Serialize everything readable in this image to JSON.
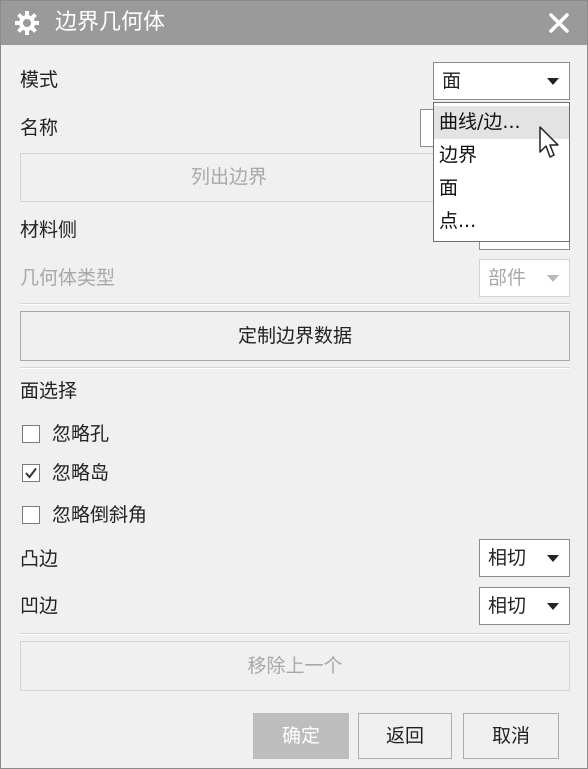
{
  "dialog": {
    "title": "边界几何体",
    "icons": {
      "settings": "gear-icon",
      "close": "close-icon"
    }
  },
  "mode": {
    "label": "模式",
    "value": "面"
  },
  "name": {
    "label": "名称"
  },
  "list_boundary_button": "列出边界",
  "material_side": {
    "label": "材料侧"
  },
  "geometry_type": {
    "label": "几何体类型",
    "value": "部件"
  },
  "custom_boundary_button": "定制边界数据",
  "face_selection": {
    "label": "面选择",
    "checkboxes": [
      {
        "label": "忽略孔",
        "checked": false
      },
      {
        "label": "忽略岛",
        "checked": true
      },
      {
        "label": "忽略倒斜角",
        "checked": false
      }
    ]
  },
  "convex_edge": {
    "label": "凸边",
    "value": "相切"
  },
  "concave_edge": {
    "label": "凹边",
    "value": "相切"
  },
  "remove_previous_button": "移除上一个",
  "footer": {
    "ok": "确定",
    "back": "返回",
    "cancel": "取消"
  },
  "mode_dropdown": {
    "options": [
      "曲线/边...",
      "边界",
      "面",
      "点..."
    ],
    "highlighted_index": 0
  },
  "colors": {
    "titlebar": "#9a9a9a",
    "background": "#f0f0f0",
    "highlight": "#e3e3e3"
  }
}
